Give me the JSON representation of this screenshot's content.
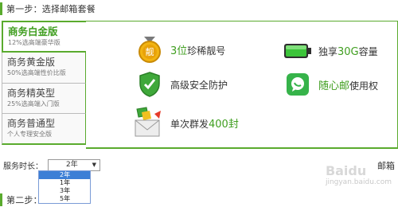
{
  "step1": {
    "title": "第一步：选择邮箱套餐"
  },
  "step2": {
    "title": "第二步："
  },
  "tabs": [
    {
      "title": "商务白金版",
      "subtitle": "12%选高端豪华版",
      "active": true
    },
    {
      "title": "商务黄金版",
      "subtitle": "50%选高端性价比版",
      "active": false
    },
    {
      "title": "商务精英型",
      "subtitle": "25%选高端入门版",
      "active": false
    },
    {
      "title": "商务普通型",
      "subtitle": "个人专理安全版",
      "active": false
    }
  ],
  "features": {
    "f1": {
      "highlight": "3位",
      "text": "珍稀靓号",
      "icon": "medal-icon",
      "badge": "靓"
    },
    "f2": {
      "prefix": "独享",
      "highlight": "30G",
      "text": "容量",
      "icon": "battery-icon"
    },
    "f3": {
      "text": "高级安全防护",
      "icon": "shield-icon"
    },
    "f4": {
      "highlight": "随心邮",
      "text": "使用权",
      "icon": "chat-icon"
    },
    "f5": {
      "prefix": "单次群发",
      "highlight": "400封",
      "icon": "envelope-icon"
    }
  },
  "service": {
    "label": "服务时长：",
    "selected": "2年",
    "options": [
      "2年",
      "1年",
      "3年",
      "5年"
    ],
    "selected_index": 0
  },
  "mailbox_label": "邮箱",
  "watermark": {
    "brand": "Baidu",
    "text": "jingyan.baidu.com"
  },
  "colors": {
    "accent": "#5aab2e",
    "highlight": "#3f9e1f",
    "select_highlight": "#3c7fd6"
  }
}
